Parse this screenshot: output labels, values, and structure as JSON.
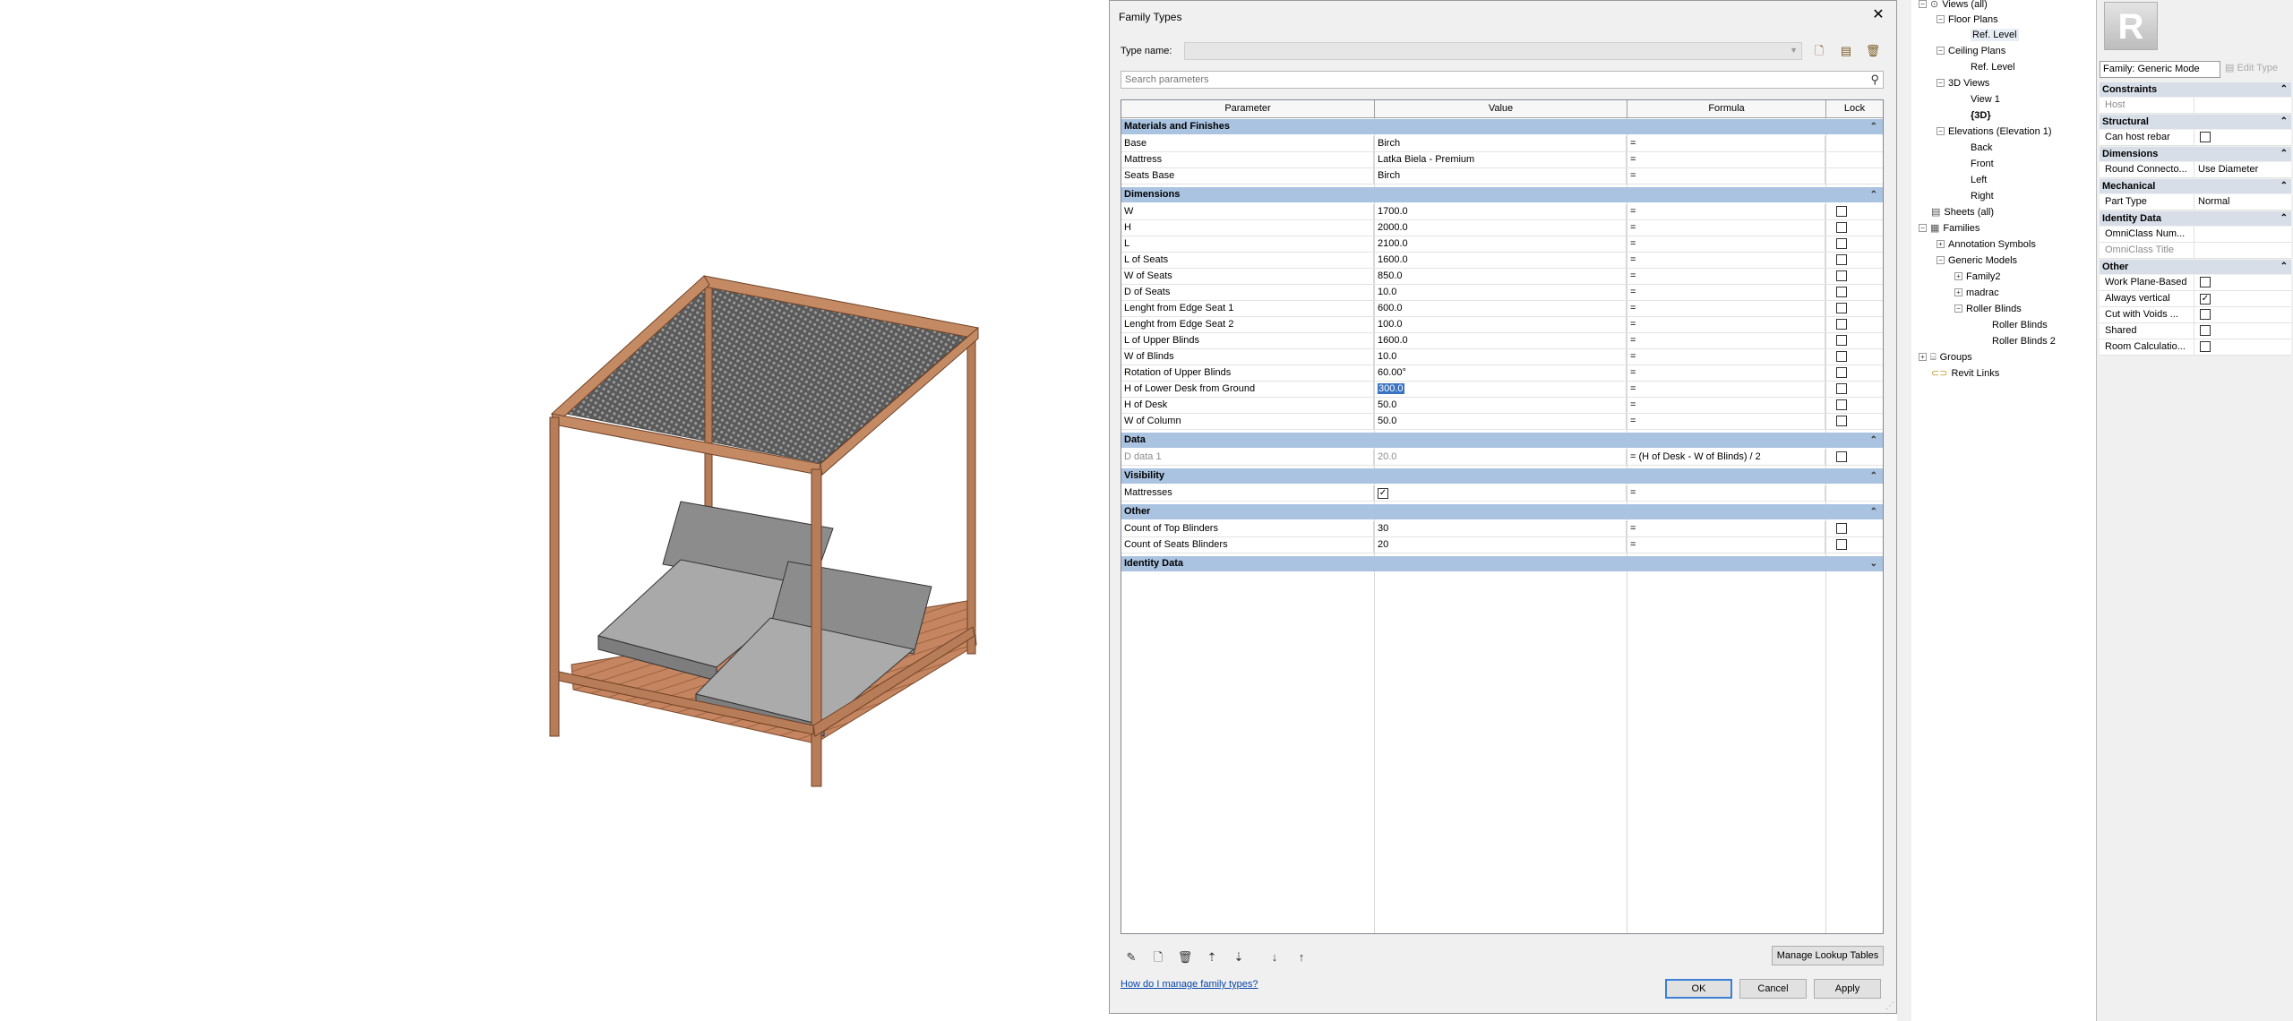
{
  "dialog": {
    "title": "Family Types",
    "type_name_label": "Type name:",
    "search_placeholder": "Search parameters",
    "columns": [
      "Parameter",
      "Value",
      "Formula",
      "Lock"
    ],
    "groups": [
      {
        "name": "Materials and Finishes",
        "rows": [
          {
            "param": "Base",
            "value": "Birch",
            "formula": "=",
            "lock": null
          },
          {
            "param": "Mattress",
            "value": "Latka Biela - Premium",
            "formula": "=",
            "lock": null
          },
          {
            "param": "Seats Base",
            "value": "Birch",
            "formula": "=",
            "lock": null
          }
        ]
      },
      {
        "name": "Dimensions",
        "rows": [
          {
            "param": "W",
            "value": "1700.0",
            "formula": "=",
            "lock": false
          },
          {
            "param": "H",
            "value": "2000.0",
            "formula": "=",
            "lock": false
          },
          {
            "param": "L",
            "value": "2100.0",
            "formula": "=",
            "lock": false
          },
          {
            "param": "L of Seats",
            "value": "1600.0",
            "formula": "=",
            "lock": false
          },
          {
            "param": "W of Seats",
            "value": "850.0",
            "formula": "=",
            "lock": false
          },
          {
            "param": "D of Seats",
            "value": "10.0",
            "formula": "=",
            "lock": false
          },
          {
            "param": "Lenght from Edge Seat 1",
            "value": "600.0",
            "formula": "=",
            "lock": false
          },
          {
            "param": "Lenght from Edge Seat 2",
            "value": "100.0",
            "formula": "=",
            "lock": false
          },
          {
            "param": "L of Upper Blinds",
            "value": "1600.0",
            "formula": "=",
            "lock": false
          },
          {
            "param": "W of Blinds",
            "value": "10.0",
            "formula": "=",
            "lock": false
          },
          {
            "param": "Rotation of Upper Blinds",
            "value": "60.00°",
            "formula": "=",
            "lock": false
          },
          {
            "param": "H of Lower Desk from Ground",
            "value": "300.0",
            "formula": "=",
            "lock": false,
            "selected": true
          },
          {
            "param": "H of Desk",
            "value": "50.0",
            "formula": "=",
            "lock": false
          },
          {
            "param": "W of Column",
            "value": "50.0",
            "formula": "=",
            "lock": false
          }
        ]
      },
      {
        "name": "Data",
        "rows": [
          {
            "param": "D data 1",
            "value": "20.0",
            "formula": "= (H of Desk - W of Blinds) / 2",
            "lock": false,
            "dim": true
          }
        ]
      },
      {
        "name": "Visibility",
        "rows": [
          {
            "param": "Mattresses",
            "value_checkbox": true,
            "formula": "=",
            "lock": null
          }
        ]
      },
      {
        "name": "Other",
        "rows": [
          {
            "param": "Count of Top Blinders",
            "value": "30",
            "formula": "=",
            "lock": false
          },
          {
            "param": "Count of Seats Blinders",
            "value": "20",
            "formula": "=",
            "lock": false
          }
        ]
      },
      {
        "name": "Identity Data",
        "rows": []
      }
    ],
    "manage_lookup": "Manage Lookup Tables",
    "help_link": "How do I manage family types?",
    "ok": "OK",
    "cancel": "Cancel",
    "apply": "Apply"
  },
  "browser": {
    "views_all": "Views (all)",
    "floor_plans": "Floor Plans",
    "ref_level_fp": "Ref. Level",
    "ceiling_plans": "Ceiling Plans",
    "ref_level_cp": "Ref. Level",
    "views_3d": "3D Views",
    "view1": "View 1",
    "view3d": "{3D}",
    "elevations": "Elevations (Elevation 1)",
    "back": "Back",
    "front": "Front",
    "left": "Left",
    "right": "Right",
    "sheets": "Sheets (all)",
    "families": "Families",
    "annotation_symbols": "Annotation Symbols",
    "generic_models": "Generic Models",
    "family2": "Family2",
    "madrac": "madrac",
    "roller_blinds": "Roller Blinds",
    "roller_blinds_a": "Roller Blinds",
    "roller_blinds_2": "Roller Blinds 2",
    "groups": "Groups",
    "revit_links": "Revit Links"
  },
  "props": {
    "logo": "R",
    "family_select": "Family: Generic Mode",
    "edit_type": "Edit Type",
    "constraints": "Constraints",
    "host": "Host",
    "structural": "Structural",
    "can_host_rebar": "Can host rebar",
    "dimensions": "Dimensions",
    "round_connector": "Round Connecto...",
    "round_connector_value": "Use Diameter",
    "mechanical": "Mechanical",
    "part_type": "Part Type",
    "part_type_value": "Normal",
    "identity_data": "Identity Data",
    "omniclass_num": "OmniClass Num...",
    "omniclass_title": "OmniClass Title",
    "other": "Other",
    "work_plane": "Work Plane-Based",
    "always_vertical": "Always vertical",
    "cut_voids": "Cut with Voids ...",
    "shared": "Shared",
    "room_calc": "Room Calculatio..."
  },
  "colors": {
    "group_header": "#a9c3e0",
    "selection": "#3a73c2",
    "wood": "#b97a57"
  }
}
